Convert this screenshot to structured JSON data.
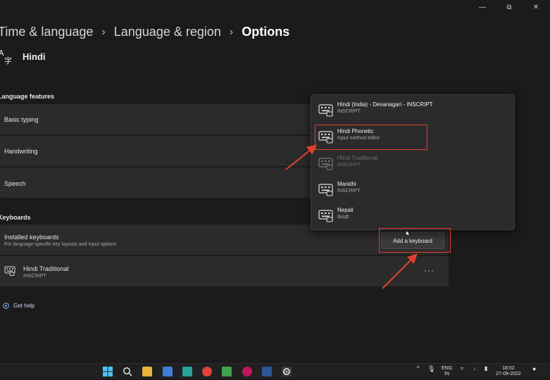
{
  "breadcrumb": {
    "items": [
      "Time & language",
      "Language & region"
    ],
    "current": "Options"
  },
  "language": {
    "title": "Hindi"
  },
  "sections": {
    "features": "Language features",
    "keyboards": "Keyboards"
  },
  "features": [
    {
      "label": "Basic typing"
    },
    {
      "label": "Handwriting"
    },
    {
      "label": "Speech"
    }
  ],
  "installed": {
    "title": "Installed keyboards",
    "subtitle": "For language-specific key layouts and input options",
    "add_button": "Add a keyboard"
  },
  "keyboard_row": {
    "name": "Hindi Traditional",
    "layout": "INSCRIPT",
    "more": "···"
  },
  "dropdown": {
    "options": [
      {
        "name": "Hindi (India) - Devanagari - INSCRIPT",
        "desc": "INSCRIPT"
      },
      {
        "name": "Hindi Phonetic",
        "desc": "Input method editor"
      },
      {
        "name": "Hindi Traditional",
        "desc": "INSCRIPT"
      },
      {
        "name": "Marathi",
        "desc": "INSCRIPT"
      },
      {
        "name": "Nepali",
        "desc": "नेपाली"
      }
    ]
  },
  "help": {
    "label": "Get help"
  },
  "taskbar": {
    "lang_top": "ENG",
    "lang_bottom": "IN",
    "time": "18:02",
    "date": "27-09-2022"
  },
  "colors": {
    "annotation": "#e0412a",
    "accent": "#4cc2ff",
    "background": "#1b1b1b",
    "card": "#2b2b2b"
  }
}
